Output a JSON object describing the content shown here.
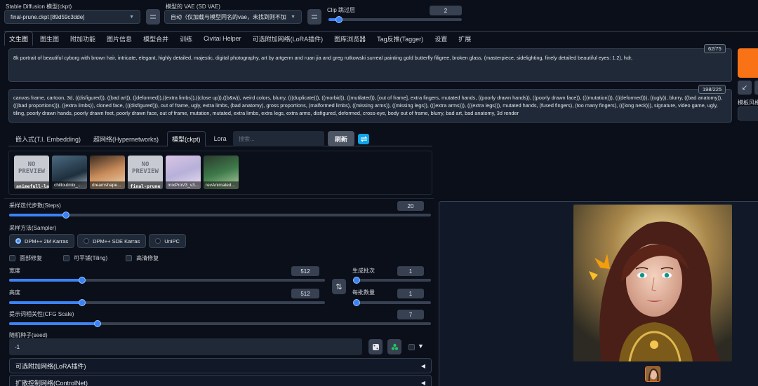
{
  "top": {
    "ckpt_label": "Stable Diffusion 模型(ckpt)",
    "ckpt_value": "final-prune.ckpt [89d59c3dde]",
    "vae_label": "模型的 VAE (SD VAE)",
    "vae_value": "自动（仅加载与模型同名的vae，未找到则不加",
    "clip_label": "Clip 跳过层",
    "clip_value": "2",
    "clip_fraction": 0.08
  },
  "tabs": [
    "文生图",
    "图生图",
    "附加功能",
    "图片信息",
    "模型合并",
    "训练",
    "Civitai Helper",
    "可选附加网络(LoRA插件)",
    "图库浏览器",
    "Tag反推(Tagger)",
    "设置",
    "扩展"
  ],
  "prompt": {
    "text": "8k portrait of beautiful cyborg with brown hair, intricate, elegant, highly detailed, majestic, digital photography, art by artgerm and ruan jia and greg rutkowski surreal painting gold butterfly filigree, broken glass, (masterpiece, sidelighting, finely detailed beautiful eyes: 1.2), hdr,",
    "counter": "62/75"
  },
  "negative": {
    "text": "canvas frame, cartoon, 3d, ((disfigured)), ((bad art)), ((deformed)),((extra limbs)),((close up)),((b&w)), weird colors, blurry, (((duplicate))), ((morbid)), ((mutilated)), [out of frame], extra fingers, mutated hands, ((poorly drawn hands)), ((poorly drawn face)), (((mutation))), (((deformed))), ((ugly)), blurry, ((bad anatomy)), (((bad proportions))), ((extra limbs)), cloned face, (((disfigured))), out of frame, ugly, extra limbs, (bad anatomy), gross proportions, (malformed limbs), ((missing arms)), ((missing legs)), (((extra arms))), (((extra legs))), mutated hands, (fused fingers), (too many fingers), (((long neck))), signature, video game, ugly, tiling, poorly drawn hands, poorly drawn feet, poorly drawn face, out of frame, mutation, mutated, extra limbs, extra legs, extra arms, disfigured, deformed, cross-eye, body out of frame, blurry, bad art, bad anatomy, 3d render",
    "counter": "198/225"
  },
  "right_panel": {
    "style_label": "模板风格"
  },
  "subtabs": [
    "嵌入式(T.I. Embedding)",
    "超网络(Hypernetworks)",
    "模型(ckpt)",
    "Lora"
  ],
  "search_placeholder": "搜索...",
  "refresh_label": "刷新",
  "models": [
    {
      "name": "animefull-lat...",
      "kind": "noprev"
    },
    {
      "name": "chilloutmix_...",
      "kind": "blue"
    },
    {
      "name": "dreamshape...",
      "kind": "warm"
    },
    {
      "name": "final-prune",
      "kind": "noprev"
    },
    {
      "name": "mixProV3_v3...",
      "kind": "pink"
    },
    {
      "name": "revAnimated...",
      "kind": "green"
    }
  ],
  "no_preview_text": "NO PREVIEW",
  "steps": {
    "label": "采样迭代步数(Steps)",
    "value": "20",
    "fraction": 0.135
  },
  "sampler": {
    "label": "采样方法(Sampler)",
    "options": [
      "DPM++ 2M Karras",
      "DPM++ SDE Karras",
      "UniPC"
    ],
    "selected": 0
  },
  "checks": [
    "面部修复",
    "可平铺(Tiling)",
    "高清修复"
  ],
  "width": {
    "label": "宽度",
    "value": "512",
    "fraction": 0.23
  },
  "height": {
    "label": "高度",
    "value": "512",
    "fraction": 0.23
  },
  "batch_count": {
    "label": "生成批次",
    "value": "1",
    "fraction": 0.0
  },
  "batch_size": {
    "label": "每批数量",
    "value": "1",
    "fraction": 0.0
  },
  "cfg": {
    "label": "提示词相关性(CFG Scale)",
    "value": "7",
    "fraction": 0.21
  },
  "seed": {
    "label": "随机种子(seed)",
    "value": "-1"
  },
  "accordions": [
    "可选附加网络(LoRA插件)",
    "扩散控制网络(ControlNet)"
  ],
  "colors": {
    "bg": "#0b0f19",
    "panel": "#1f2937",
    "accent": "#3b82f6",
    "generate": "#f97316"
  }
}
